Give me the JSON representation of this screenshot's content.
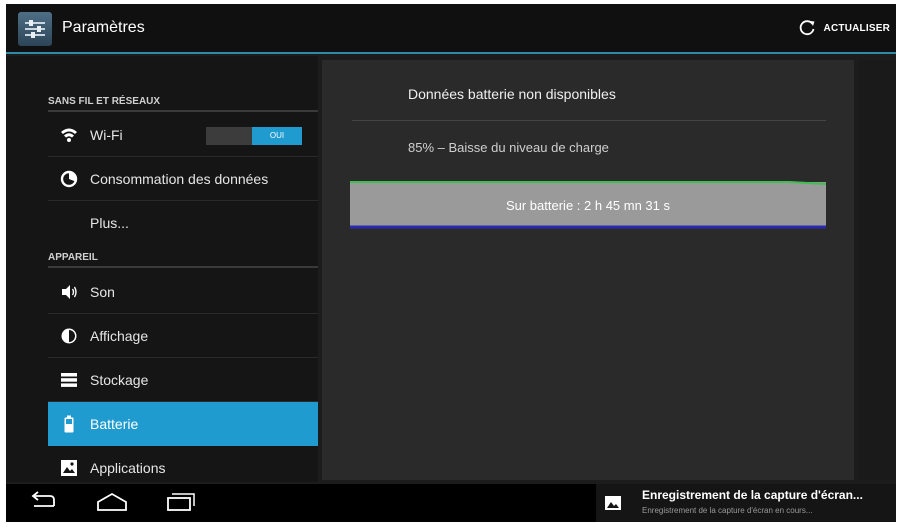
{
  "header": {
    "title": "Paramètres",
    "refresh_label": "ACTUALISER",
    "app_icon": "settings-sliders-icon",
    "refresh_icon": "refresh-icon"
  },
  "sidebar": {
    "sections": [
      {
        "header": "SANS FIL ET RÉSEAUX",
        "items": [
          {
            "label": "Wi-Fi",
            "icon": "wifi-icon",
            "toggle": "OUI"
          },
          {
            "label": "Consommation des données",
            "icon": "data-usage-icon"
          },
          {
            "label": "Plus...",
            "icon": ""
          }
        ]
      },
      {
        "header": "APPAREIL",
        "items": [
          {
            "label": "Son",
            "icon": "speaker-icon"
          },
          {
            "label": "Affichage",
            "icon": "brightness-icon"
          },
          {
            "label": "Stockage",
            "icon": "storage-icon"
          },
          {
            "label": "Batterie",
            "icon": "battery-icon",
            "selected": true
          },
          {
            "label": "Applications",
            "icon": "apps-icon"
          }
        ]
      }
    ]
  },
  "content": {
    "status": "Données batterie non disponibles",
    "level": "85% – Baisse du niveau de charge",
    "graph_label": "Sur batterie : 2 h 45 mn 31 s"
  },
  "notification": {
    "title": "Enregistrement de la capture d'écran...",
    "subtitle": "Enregistrement de la capture d'écran en cours..."
  },
  "colors": {
    "accent": "#1f9bd0",
    "action_bar_line": "#2e8ba6",
    "graph_fill": "#9a9a9a",
    "graph_top": "#3fbf4f",
    "graph_bottom": "#2a2ab0"
  }
}
